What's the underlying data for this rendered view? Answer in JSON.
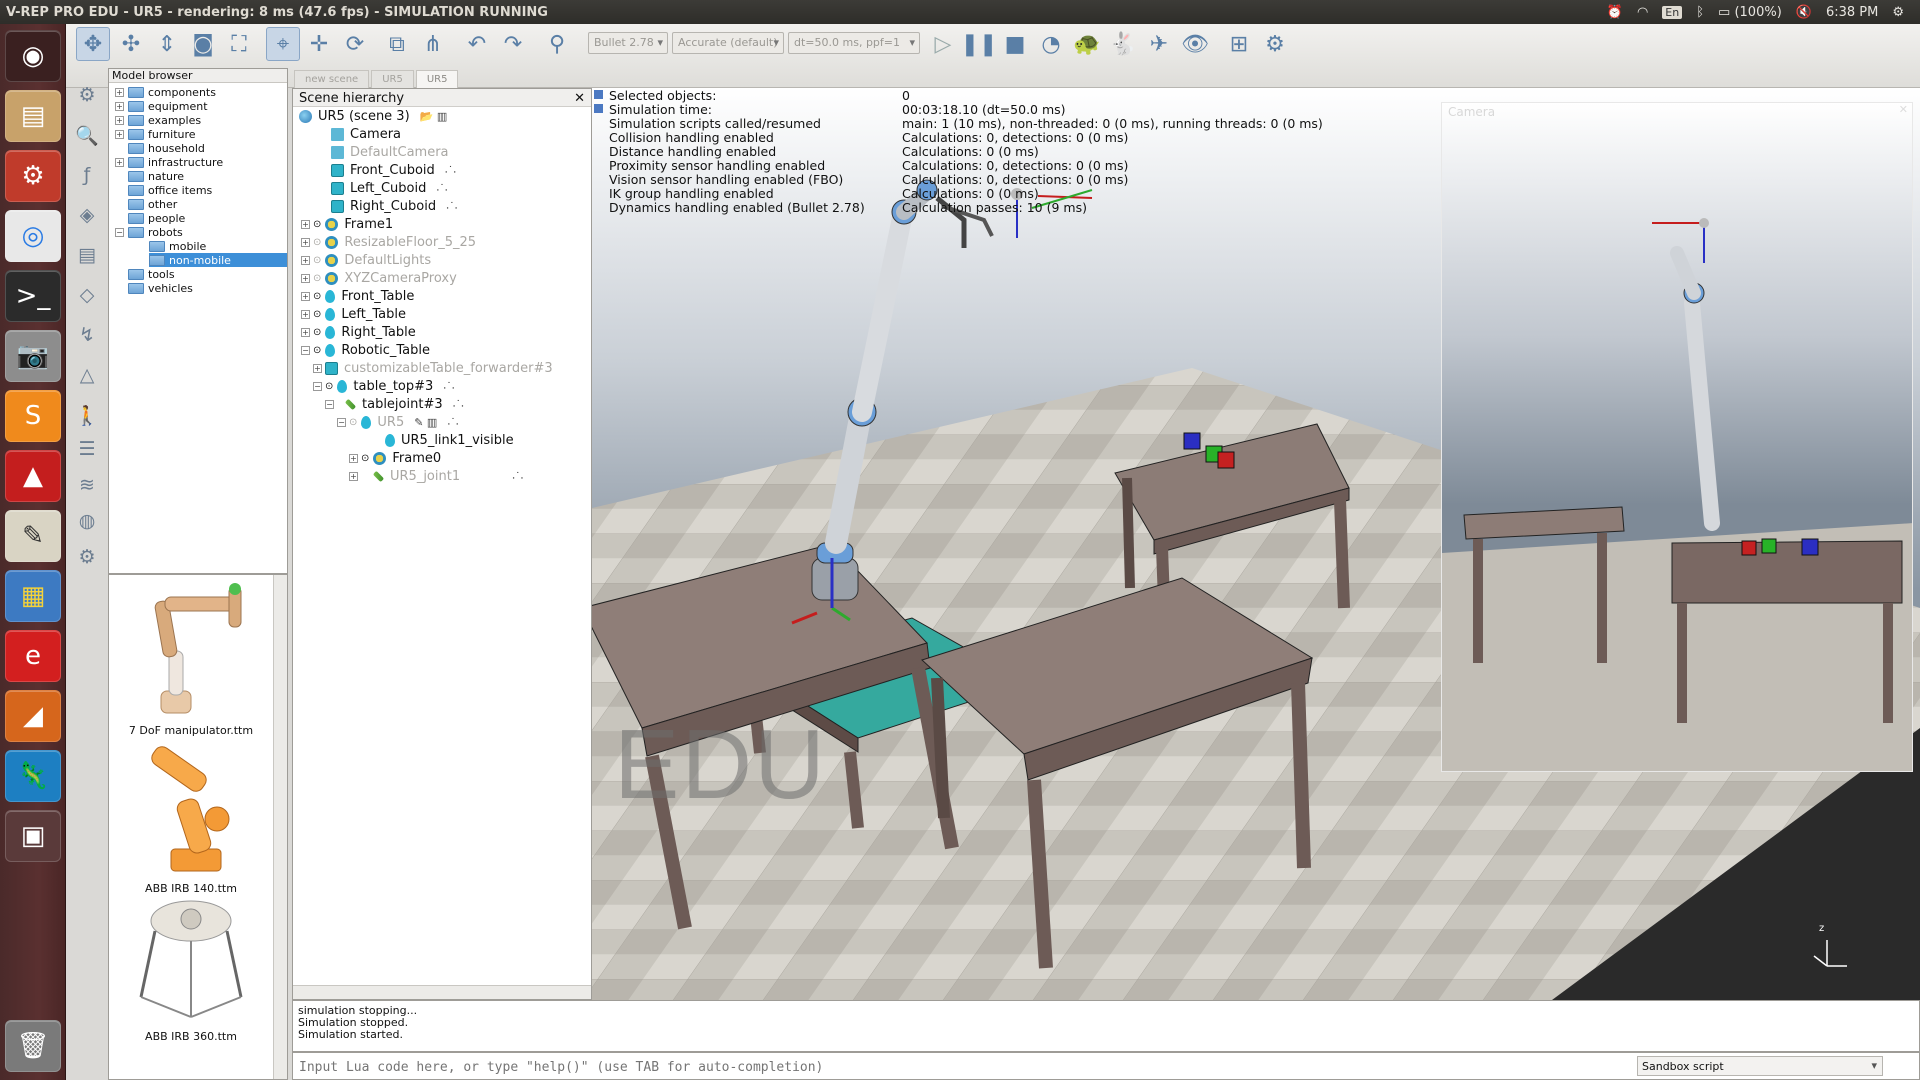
{
  "window_title": "V-REP PRO EDU - UR5 - rendering: 8 ms (47.6 fps) - SIMULATION RUNNING",
  "topbar": {
    "lang": "En",
    "battery": "(100%)",
    "time": "6:38 PM"
  },
  "toolbar": {
    "physics_engine": "Bullet 2.78",
    "accuracy": "Accurate (default)",
    "timestep": "dt=50.0 ms, ppf=1"
  },
  "model_browser": {
    "title": "Model browser",
    "items": [
      "components",
      "equipment",
      "examples",
      "furniture",
      "household",
      "infrastructure",
      "nature",
      "office items",
      "other",
      "people",
      "robots",
      "mobile",
      "non-mobile",
      "tools",
      "vehicles"
    ],
    "thumbnails": [
      "7 DoF manipulator.ttm",
      "ABB IRB 140.ttm",
      "ABB IRB 360.ttm"
    ]
  },
  "tabs": [
    "new scene",
    "UR5",
    "UR5"
  ],
  "hierarchy": {
    "title": "Scene hierarchy",
    "close": "✕",
    "items": [
      "UR5 (scene 3)",
      "Camera",
      "DefaultCamera",
      "Front_Cuboid",
      "Left_Cuboid",
      "Right_Cuboid",
      "Frame1",
      "ResizableFloor_5_25",
      "DefaultLights",
      "XYZCameraProxy",
      "Front_Table",
      "Left_Table",
      "Right_Table",
      "Robotic_Table",
      "customizableTable_forwarder#3",
      "table_top#3",
      "tablejoint#3",
      "UR5",
      "UR5_link1_visible",
      "Frame0",
      "UR5_joint1"
    ]
  },
  "info": {
    "rows": [
      {
        "k": "Selected objects:",
        "v": "0"
      },
      {
        "k": "Simulation time:",
        "v": "00:03:18.10 (dt=50.0 ms)"
      },
      {
        "k": "Simulation scripts called/resumed",
        "v": "main: 1 (10 ms), non-threaded: 0 (0 ms), running threads: 0 (0 ms)"
      },
      {
        "k": "Collision handling enabled",
        "v": "Calculations: 0, detections: 0 (0 ms)"
      },
      {
        "k": "Distance handling enabled",
        "v": "Calculations: 0 (0 ms)"
      },
      {
        "k": "Proximity sensor handling enabled",
        "v": "Calculations: 0, detections: 0 (0 ms)"
      },
      {
        "k": "Vision sensor handling enabled (FBO)",
        "v": "Calculations: 0, detections: 0 (0 ms)"
      },
      {
        "k": "IK group handling enabled",
        "v": "Calculations: 0 (0 ms)"
      },
      {
        "k": "Dynamics handling enabled (Bullet 2.78)",
        "v": "Calculation passes: 10 (9 ms)"
      }
    ]
  },
  "viewport": {
    "watermark": "EDU",
    "camera_window_title": "Camera",
    "axis_label": "z"
  },
  "console": {
    "lines": [
      "simulation stopping...",
      "Simulation stopped.",
      "Simulation started."
    ]
  },
  "lua": {
    "placeholder": "Input Lua code here, or type \"help()\" (use TAB for auto-completion)",
    "script_select": "Sandbox script"
  }
}
